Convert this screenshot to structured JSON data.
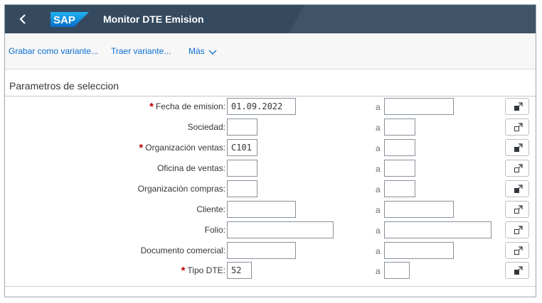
{
  "shell": {
    "back_icon": "chevron-left-icon",
    "logo_text": "SAP",
    "title": "Monitor DTE Emision",
    "bar_color": "#354a5f"
  },
  "toolbar": {
    "save_variant": "Grabar como variante...",
    "get_variant": "Traer variante...",
    "more": "Más"
  },
  "section": {
    "title": "Parametros de seleccion"
  },
  "range_separator": "a",
  "rows": [
    {
      "label": "Fecha de emision:",
      "required": true,
      "from_value": "01.09.2022",
      "to_value": "",
      "multi_icon": "multiple-selection-filled-icon"
    },
    {
      "label": "Sociedad:",
      "required": false,
      "from_value": "",
      "to_value": "",
      "multi_icon": "multiple-selection-empty-icon"
    },
    {
      "label": "Organización ventas:",
      "required": true,
      "from_value": "C101",
      "to_value": "",
      "multi_icon": "multiple-selection-filled-icon"
    },
    {
      "label": "Oficina de ventas:",
      "required": false,
      "from_value": "",
      "to_value": "",
      "multi_icon": "multiple-selection-empty-icon"
    },
    {
      "label": "Organización compras:",
      "required": false,
      "from_value": "",
      "to_value": "",
      "multi_icon": "multiple-selection-filled-icon"
    },
    {
      "label": "Cliente:",
      "required": false,
      "from_value": "",
      "to_value": "",
      "multi_icon": "multiple-selection-empty-icon"
    },
    {
      "label": "Folio:",
      "required": false,
      "from_value": "",
      "to_value": "",
      "multi_icon": "multiple-selection-empty-icon"
    },
    {
      "label": "Documento comercial:",
      "required": false,
      "from_value": "",
      "to_value": "",
      "multi_icon": "multiple-selection-empty-icon"
    },
    {
      "label": "Tipo DTE:",
      "required": true,
      "from_value": "52",
      "to_value": "",
      "multi_icon": "multiple-selection-filled-icon"
    }
  ],
  "required_marker": "*"
}
